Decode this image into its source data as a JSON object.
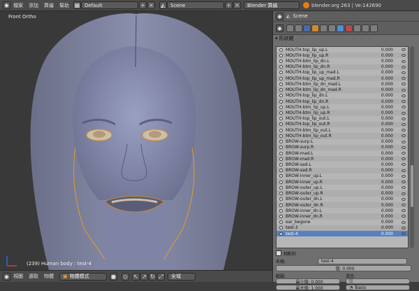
{
  "topbar": {
    "menus": [
      "檔案",
      "添加",
      "算繪",
      "幫助"
    ],
    "layout": "Default",
    "scene": "Scene",
    "engine": "Blender 算繪",
    "info": "blender.org 263 | Ve:142690"
  },
  "viewport": {
    "view_label": "Front Ortho",
    "status": "(239) Human body : test-4"
  },
  "bottombar": {
    "menus": [
      "視圖",
      "選取",
      "物體"
    ],
    "mode": "物體模式",
    "scope": "全域"
  },
  "properties": {
    "breadcrumb": "Scene",
    "panel_title": "形狀鍵",
    "shape_keys": [
      {
        "name": "MOUTH-top_lip_up.L",
        "value": "0.000"
      },
      {
        "name": "MOUTH-top_lip_up.R",
        "value": "0.000"
      },
      {
        "name": "MOUTH-btm_lip_dn.L",
        "value": "0.000"
      },
      {
        "name": "MOUTH-btm_lip_dn.R",
        "value": "0.000"
      },
      {
        "name": "MOUTH-top_lip_up_mad.L",
        "value": "0.000"
      },
      {
        "name": "MOUTH-top_lip_up_mad.R",
        "value": "0.000"
      },
      {
        "name": "MOUTH-btm_lip_dn_mad.L",
        "value": "0.000"
      },
      {
        "name": "MOUTH-btm_lip_dn_mad.R",
        "value": "0.000"
      },
      {
        "name": "MOUTH-top_lip_dn.L",
        "value": "0.000"
      },
      {
        "name": "MOUTH-top_lip_dn.R",
        "value": "0.000"
      },
      {
        "name": "MOUTH-btm_lip_up.L",
        "value": "0.000"
      },
      {
        "name": "MOUTH-btm_lip_up.R",
        "value": "0.000"
      },
      {
        "name": "MOUTH-top_lip_out.L",
        "value": "0.000"
      },
      {
        "name": "MOUTH-top_lip_out.R",
        "value": "0.000"
      },
      {
        "name": "MOUTH-btm_lip_out.L",
        "value": "0.000"
      },
      {
        "name": "MOUTH-btm_lip_out.R",
        "value": "0.000"
      },
      {
        "name": "BROW-surp.L",
        "value": "0.000"
      },
      {
        "name": "BROW-surp.R",
        "value": "0.000"
      },
      {
        "name": "BROW-mad.L",
        "value": "0.000"
      },
      {
        "name": "BROW-mad.R",
        "value": "0.000"
      },
      {
        "name": "BROW-sad.L",
        "value": "0.000"
      },
      {
        "name": "BROW-sad.R",
        "value": "0.000"
      },
      {
        "name": "BROW-inner_up.L",
        "value": "0.000"
      },
      {
        "name": "BROW-inner_up.R",
        "value": "0.000"
      },
      {
        "name": "BROW-outer_up.L",
        "value": "0.000"
      },
      {
        "name": "BROW-outer_up.R",
        "value": "0.000"
      },
      {
        "name": "BROW-outer_dn.L",
        "value": "0.000"
      },
      {
        "name": "BROW-outer_dn.R",
        "value": "0.000"
      },
      {
        "name": "BROW-inner_dn.L",
        "value": "0.000"
      },
      {
        "name": "BROW-inner_dn.R",
        "value": "0.000"
      },
      {
        "name": "ear_begone",
        "value": "0.000"
      },
      {
        "name": "test-3",
        "value": "0.000"
      },
      {
        "name": "test-4",
        "value": "0.000"
      }
    ],
    "active_index": 32,
    "relative_label": "相對的",
    "name_label": "名稱:",
    "name_value": "test-4",
    "value_field": "值: 0.000",
    "range_label": "範圍:",
    "range_min": "最小值: 0.000",
    "range_max": "最大值: 1.000",
    "blend_label": "混合:",
    "basis": "Basis"
  }
}
